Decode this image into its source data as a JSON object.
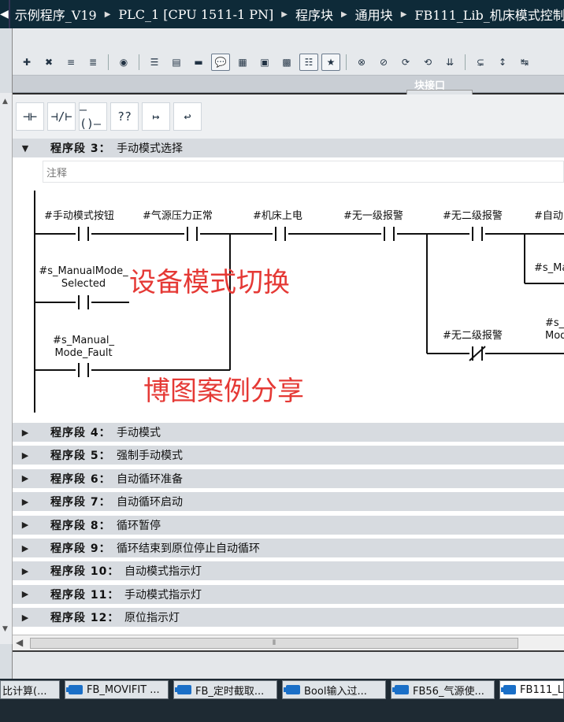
{
  "breadcrumb": [
    "示例程序_V19",
    "PLC_1 [CPU 1511-1 PN]",
    "程序块",
    "通用块",
    "FB111_Lib_机床模式控制"
  ],
  "interface_label": "块接口",
  "favorites": [
    "⊣⊢",
    "⊣/⊢",
    "–()–",
    "??",
    "↦",
    "↩"
  ],
  "network3": {
    "number": "程序段 3：",
    "title": "手动模式选择",
    "comment": "注释",
    "contacts": {
      "c1": "#手动模式按钮",
      "c2": "#气源压力正常",
      "c3": "#机床上电",
      "c4": "#无一级报警",
      "c5": "#无二级报警",
      "c6": "#自动",
      "c7_l1": "#s_ManualMode_",
      "c7_l2": "Selected",
      "c8_l1": "#s_Manual_",
      "c8_l2": "Mode_Fault",
      "c9": "#无二级报警",
      "c10": "#s_Ma",
      "c11_l1": "#s_M",
      "c11_l2": "Mod"
    },
    "watermark1": "设备模式切换",
    "watermark2": "博图案例分享"
  },
  "networks": [
    {
      "number": "程序段 4：",
      "title": "手动模式"
    },
    {
      "number": "程序段 5：",
      "title": "强制手动模式"
    },
    {
      "number": "程序段 6：",
      "title": "自动循环准备"
    },
    {
      "number": "程序段 7：",
      "title": "自动循环启动"
    },
    {
      "number": "程序段 8：",
      "title": "循环暂停"
    },
    {
      "number": "程序段 9：",
      "title": "循环结束到原位停止自动循环"
    },
    {
      "number": "程序段 10：",
      "title": "自动模式指示灯"
    },
    {
      "number": "程序段 11：",
      "title": "手动模式指示灯"
    },
    {
      "number": "程序段 12：",
      "title": "原位指示灯"
    }
  ],
  "taskbar": [
    "比计算(...",
    "FB_MOVIFIT ...",
    "FB_定时截取...",
    "Bool输入过...",
    "FB56_气源使...",
    "FB111_L"
  ],
  "colors": {
    "accent": "#0e2a38",
    "watermark": "#e53935",
    "segment_header": "#d7dbe0"
  }
}
